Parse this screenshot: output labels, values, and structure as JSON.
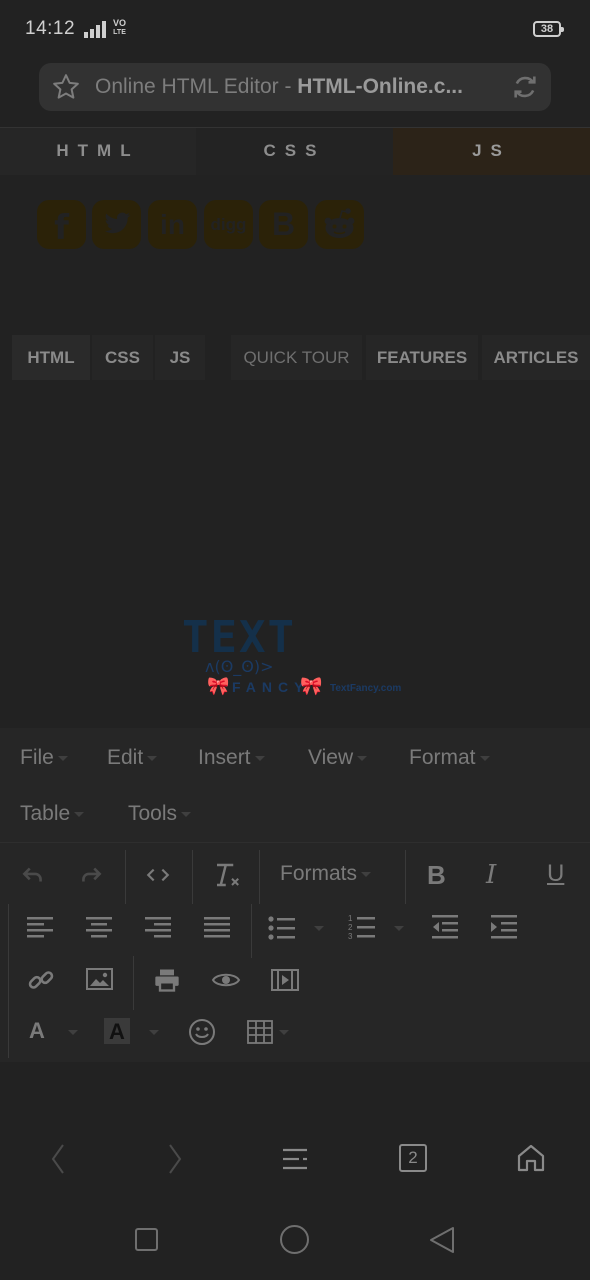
{
  "status": {
    "time": "14:12",
    "volte_top": "VO",
    "volte_bottom": "LTE",
    "battery": "38"
  },
  "browser": {
    "url_title_normal": "Online HTML Editor - ",
    "url_title_bold": "HTML-Online.c...",
    "tab_count": "2"
  },
  "top_tabs": [
    "HTML",
    "CSS",
    "JS"
  ],
  "social": [
    "f",
    "t",
    "in",
    "digg",
    "B",
    "reddit"
  ],
  "nav": [
    "HTML",
    "CSS",
    "JS",
    "QUICK TOUR",
    "FEATURES",
    "ARTICLES"
  ],
  "logo": {
    "text": "TEXT",
    "face": "ʌ(ʘ_ʘ)>",
    "fancy": "FANCY",
    "domain": "TextFancy.com"
  },
  "editor": {
    "menus": [
      "File",
      "Edit",
      "Insert",
      "View",
      "Format",
      "Table",
      "Tools"
    ],
    "formats_label": "Formats"
  },
  "colors": {
    "background": "#222222",
    "js_tab": "#2c2318",
    "social": "#2b2208",
    "logo": "#14304a"
  }
}
